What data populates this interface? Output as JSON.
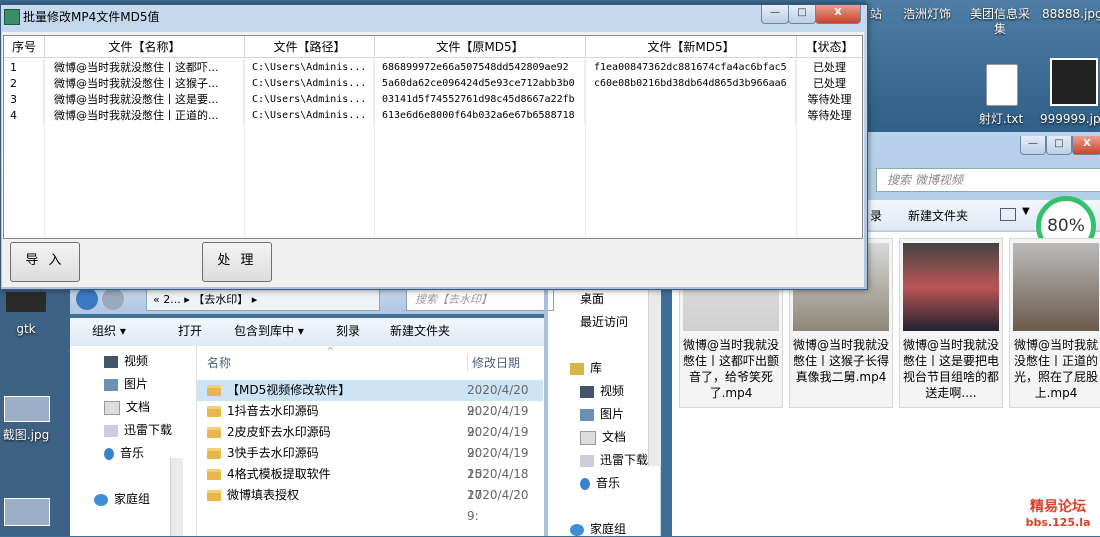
{
  "app": {
    "title": "批量修改MP4文件MD5值",
    "minimize": "—",
    "maximize": "□",
    "close": "X",
    "columns": [
      "序号",
      "文件【名称】",
      "文件【路径】",
      "文件【原MD5】",
      "文件【新MD5】",
      "【状态】"
    ],
    "rows": [
      {
        "index": "1",
        "name": "微博@当时我就没憋住丨这都吓...",
        "path": "C:\\Users\\Adminis...",
        "md5_old": "686899972e66a507548dd542809ae92",
        "md5_new": "f1ea00847362dc881674cfa4ac6bfac5",
        "status": "已处理"
      },
      {
        "index": "2",
        "name": "微博@当时我就没憋住丨这猴子...",
        "path": "C:\\Users\\Adminis...",
        "md5_old": "5a60da62ce096424d5e93ce712abb3b0",
        "md5_new": "c60e08b0216bd38db64d865d3b966aa6",
        "status": "已处理"
      },
      {
        "index": "3",
        "name": "微博@当时我就没憋住丨这是要...",
        "path": "C:\\Users\\Adminis...",
        "md5_old": "03141d5f74552761d98c45d8667a22fb",
        "md5_new": "",
        "status": "等待处理"
      },
      {
        "index": "4",
        "name": "微博@当时我就没憋住丨正道的...",
        "path": "C:\\Users\\Adminis...",
        "md5_old": "613e6d6e8000f64b032a6e67b6588718",
        "md5_new": "",
        "status": "等待处理"
      }
    ],
    "import_label": "导 入",
    "process_label": "处 理"
  },
  "desktop": {
    "top_labels": [
      "站",
      "浩洲灯饰",
      "美团信息采集",
      "88888.jpg"
    ],
    "files": [
      {
        "label": "射灯.txt"
      },
      {
        "label": "999999.jp"
      }
    ],
    "left_labels": [
      "gtk",
      "截图.jpg"
    ]
  },
  "right_explorer": {
    "search_placeholder": "搜索 微博视频",
    "toolbar_partial": "录",
    "new_folder": "新建文件夹",
    "progress": "80%",
    "progress_value": 80,
    "thumbs": [
      {
        "caption": "微博@当时我就没憋住丨这都吓出颤音了，给爷笑死了.mp4"
      },
      {
        "caption": "微博@当时我就没憋住丨这猴子长得真像我二舅.mp4"
      },
      {
        "caption": "微博@当时我就没憋住丨这是要把电视台节目组啥的都送走啊...."
      },
      {
        "caption": "微博@当时我就没憋住丨正道的光，照在了屁股上.mp4"
      }
    ]
  },
  "mid_nav": {
    "items": [
      "桌面",
      "最近访问",
      "库",
      "视频",
      "图片",
      "文档",
      "迅雷下载",
      "音乐",
      "家庭组"
    ]
  },
  "left_explorer": {
    "breadcrumb": "« 2... ▸ 【去水印】 ▸",
    "search_placeholder": "搜索【去水印】",
    "toolbar": [
      "组织 ▾",
      "打开",
      "包含到库中 ▾",
      "刻录",
      "新建文件夹"
    ],
    "nav": [
      "视频",
      "图片",
      "文档",
      "迅雷下载",
      "音乐",
      "家庭组"
    ],
    "col_name": "名称",
    "col_date": "修改日期",
    "files": [
      {
        "name": "【MD5视频修改软件】",
        "date": "2020/4/20 9:"
      },
      {
        "name": "1抖音去水印源码",
        "date": "2020/4/19 9:"
      },
      {
        "name": "2皮皮虾去水印源码",
        "date": "2020/4/19 9:"
      },
      {
        "name": "3快手去水印源码",
        "date": "2020/4/19 15"
      },
      {
        "name": "4格式模板提取软件",
        "date": "2020/4/18 17"
      },
      {
        "name": "微博填表授权",
        "date": "2020/4/20 9:"
      }
    ]
  },
  "watermark": {
    "line1": "精易论坛",
    "line2": "bbs.125.la"
  },
  "colors": {
    "accent_progress": "#35c16b",
    "watermark": "#d9402a"
  }
}
